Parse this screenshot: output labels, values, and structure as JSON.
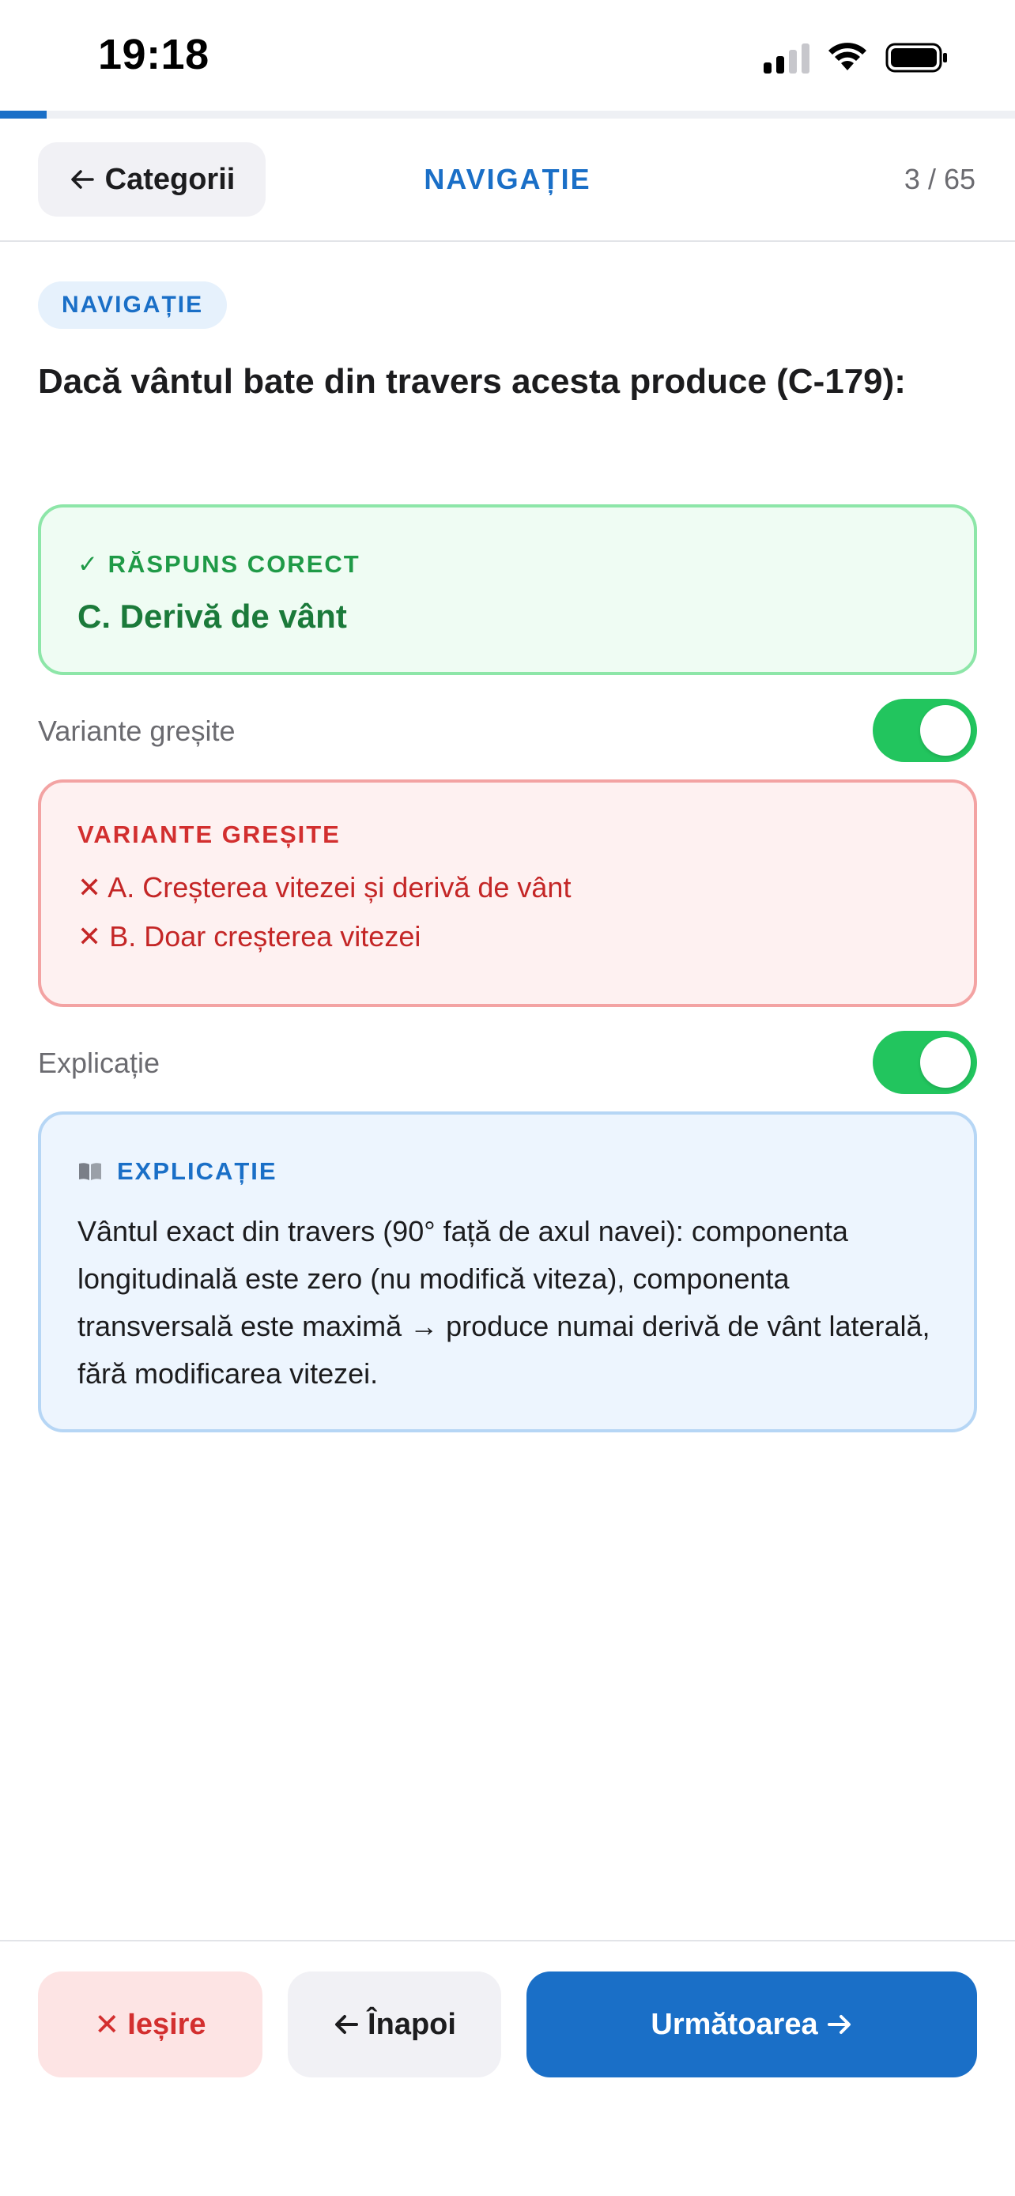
{
  "status": {
    "time": "19:18"
  },
  "progress": {
    "fraction": 0.046
  },
  "header": {
    "back_label": "Categorii",
    "title": "NAVIGAȚIE",
    "counter": "3 / 65"
  },
  "question": {
    "category": "NAVIGAȚIE",
    "text": "Dacă vântul bate din travers acesta produce (C-179):"
  },
  "correct": {
    "label": "RĂSPUNS CORECT",
    "answer": "C. Derivă de vânt"
  },
  "wrong_toggle": {
    "label": "Variante greșite",
    "on": true
  },
  "wrong": {
    "label": "VARIANTE GREȘITE",
    "items": [
      "A. Creșterea vitezei și derivă de vânt",
      "B. Doar creșterea vitezei"
    ]
  },
  "explain_toggle": {
    "label": "Explicație",
    "on": true
  },
  "explanation": {
    "label": "EXPLICAȚIE",
    "text": "Vântul exact din travers (90° față de axul navei): componenta longitudinală este zero (nu modifică viteza), componenta transversală este maximă → produce numai derivă de vânt laterală, fără modificarea vitezei."
  },
  "bottom": {
    "exit_label": "Ieșire",
    "back_label": "Înapoi",
    "next_label": "Următoarea"
  },
  "colors": {
    "accent": "#1a6fc7",
    "success": "#22c55e",
    "error": "#d32f2f"
  }
}
